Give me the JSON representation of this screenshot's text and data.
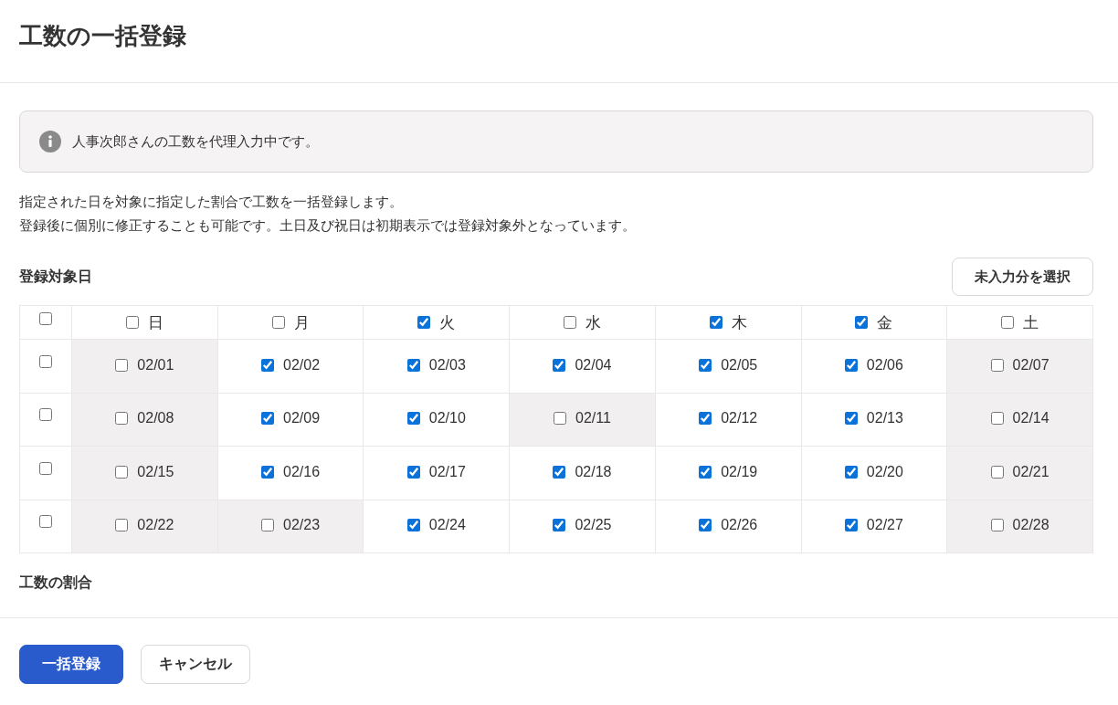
{
  "dialog": {
    "title": "工数の一括登録"
  },
  "notice": {
    "text": "人事次郎さんの工数を代理入力中です。"
  },
  "description": [
    "指定された日を対象に指定した割合で工数を一括登録します。",
    "登録後に個別に修正することも可能です。土日及び祝日は初期表示では登録対象外となっています。"
  ],
  "target_days": {
    "label": "登録対象日",
    "select_button": "未入力分を選択",
    "table": {
      "select_all": {
        "checked": false
      },
      "columns": [
        {
          "label": "日",
          "checked": false
        },
        {
          "label": "月",
          "checked": false
        },
        {
          "label": "火",
          "checked": true
        },
        {
          "label": "水",
          "checked": false
        },
        {
          "label": "木",
          "checked": true
        },
        {
          "label": "金",
          "checked": true
        },
        {
          "label": "土",
          "checked": false
        }
      ],
      "rows": [
        {
          "checked": false,
          "days": [
            {
              "date": "02/01",
              "checked": false,
              "off_day": true
            },
            {
              "date": "02/02",
              "checked": true,
              "off_day": false
            },
            {
              "date": "02/03",
              "checked": true,
              "off_day": false
            },
            {
              "date": "02/04",
              "checked": true,
              "off_day": false
            },
            {
              "date": "02/05",
              "checked": true,
              "off_day": false
            },
            {
              "date": "02/06",
              "checked": true,
              "off_day": false
            },
            {
              "date": "02/07",
              "checked": false,
              "off_day": true
            }
          ]
        },
        {
          "checked": false,
          "days": [
            {
              "date": "02/08",
              "checked": false,
              "off_day": true
            },
            {
              "date": "02/09",
              "checked": true,
              "off_day": false
            },
            {
              "date": "02/10",
              "checked": true,
              "off_day": false
            },
            {
              "date": "02/11",
              "checked": false,
              "off_day": true
            },
            {
              "date": "02/12",
              "checked": true,
              "off_day": false
            },
            {
              "date": "02/13",
              "checked": true,
              "off_day": false
            },
            {
              "date": "02/14",
              "checked": false,
              "off_day": true
            }
          ]
        },
        {
          "checked": false,
          "days": [
            {
              "date": "02/15",
              "checked": false,
              "off_day": true
            },
            {
              "date": "02/16",
              "checked": true,
              "off_day": false
            },
            {
              "date": "02/17",
              "checked": true,
              "off_day": false
            },
            {
              "date": "02/18",
              "checked": true,
              "off_day": false
            },
            {
              "date": "02/19",
              "checked": true,
              "off_day": false
            },
            {
              "date": "02/20",
              "checked": true,
              "off_day": false
            },
            {
              "date": "02/21",
              "checked": false,
              "off_day": true
            }
          ]
        },
        {
          "checked": false,
          "days": [
            {
              "date": "02/22",
              "checked": false,
              "off_day": true
            },
            {
              "date": "02/23",
              "checked": false,
              "off_day": true
            },
            {
              "date": "02/24",
              "checked": true,
              "off_day": false
            },
            {
              "date": "02/25",
              "checked": true,
              "off_day": false
            },
            {
              "date": "02/26",
              "checked": true,
              "off_day": false
            },
            {
              "date": "02/27",
              "checked": true,
              "off_day": false
            },
            {
              "date": "02/28",
              "checked": false,
              "off_day": true
            }
          ]
        }
      ]
    }
  },
  "ratio": {
    "label": "工数の割合"
  },
  "buttons": [
    {
      "label": "一括登録",
      "kind": "primary"
    },
    {
      "label": "キャンセル",
      "kind": "secondary"
    }
  ]
}
